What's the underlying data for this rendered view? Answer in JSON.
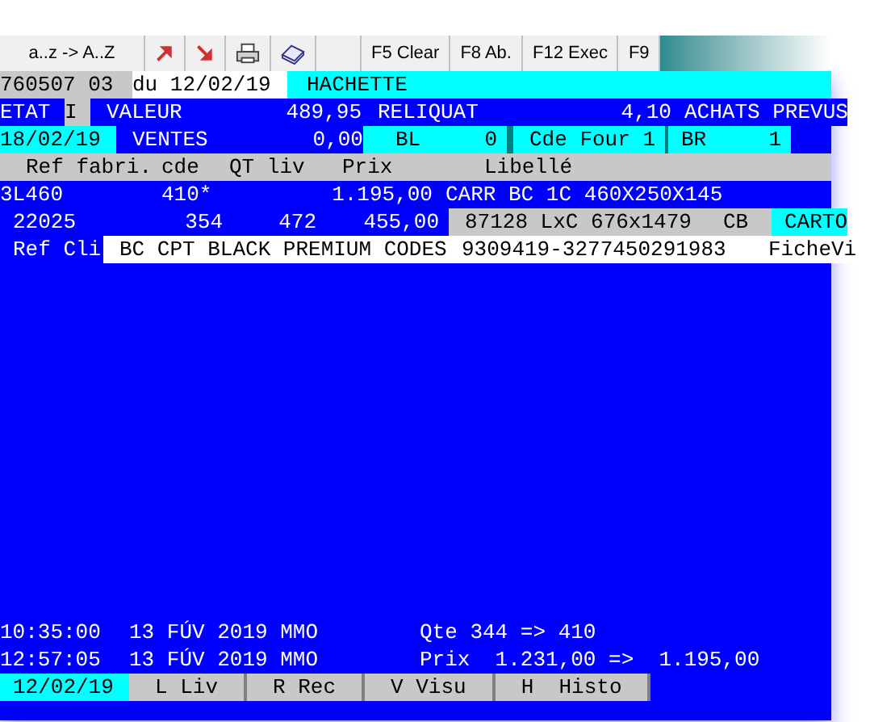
{
  "toolbar": {
    "sort_button": "a..z -> A..Z",
    "function_keys": [
      "F5 Clear",
      "F8 Ab.",
      "F12 Exec",
      "F9"
    ]
  },
  "summary_rows": [
    [
      {
        "text": "760507 03",
        "kind": "grey"
      },
      {
        "text": "du 12/02/19",
        "kind": "white"
      },
      {
        "text": "HACHETTE",
        "kind": "cyan"
      }
    ],
    [
      {
        "text": "ETAT",
        "kind": "blue"
      },
      {
        "text": "I",
        "kind": "grey"
      },
      {
        "text": "VALEUR",
        "kind": "blue"
      },
      {
        "text": "489,95",
        "kind": "blue"
      },
      {
        "text": "RELIQUAT",
        "kind": "blue"
      },
      {
        "text": "4,10",
        "kind": "blue"
      },
      {
        "text": "ACHATS PREVUS",
        "kind": "blue"
      }
    ],
    [
      {
        "text": "18/02/19",
        "kind": "cyan"
      },
      {
        "text": "VENTES",
        "kind": "blue"
      },
      {
        "text": "0,00",
        "kind": "blue"
      },
      {
        "text": "BL",
        "kind": "cyan"
      },
      {
        "text": "0",
        "kind": "cyan"
      },
      {
        "text": "Cde Four 1",
        "kind": "cyan"
      },
      {
        "text": "BR",
        "kind": "cyan"
      },
      {
        "text": "1",
        "kind": "cyan"
      }
    ]
  ],
  "table": {
    "columns": [
      "Ref fabri.",
      "cde",
      "QT liv",
      "Prix",
      "Libellé"
    ],
    "rows": [
      [
        {
          "text": "3L460",
          "kind": "blue"
        },
        {
          "text": "410*",
          "kind": "blue"
        },
        {
          "text": "",
          "kind": "blue"
        },
        {
          "text": "1.195,00",
          "kind": "blue"
        },
        {
          "text": "CARR BC 1C 460X250X145",
          "kind": "blue"
        }
      ],
      [
        {
          "text": "22025",
          "kind": "blue"
        },
        {
          "text": "354",
          "kind": "blue"
        },
        {
          "text": "472",
          "kind": "blue"
        },
        {
          "text": "455,00",
          "kind": "blue"
        },
        {
          "text": "87128 LxC 676x1479",
          "kind": "grey"
        },
        {
          "text": "CB",
          "kind": "grey"
        },
        {
          "text": "CARTO",
          "kind": "cyan"
        }
      ]
    ]
  },
  "reference_line": [
    {
      "text": "Ref Cli",
      "kind": "blue"
    },
    {
      "text": "BC CPT BLACK PREMIUM CODES",
      "kind": "white"
    },
    {
      "text": "9309419-3277450291983",
      "kind": "white"
    },
    {
      "text": "FicheVi",
      "kind": "white"
    }
  ],
  "history": [
    [
      "10:35:00",
      "13 FÚV 2019 MMO",
      "Qte 344 => 410"
    ],
    [
      "12:57:05",
      "13 FÚV 2019 MMO",
      "Prix  1.231,00 =>  1.195,00"
    ]
  ],
  "status_bar": {
    "date": "12/02/19",
    "keys": [
      "L Liv",
      "R Rec",
      "V Visu",
      "H  Histo"
    ]
  }
}
